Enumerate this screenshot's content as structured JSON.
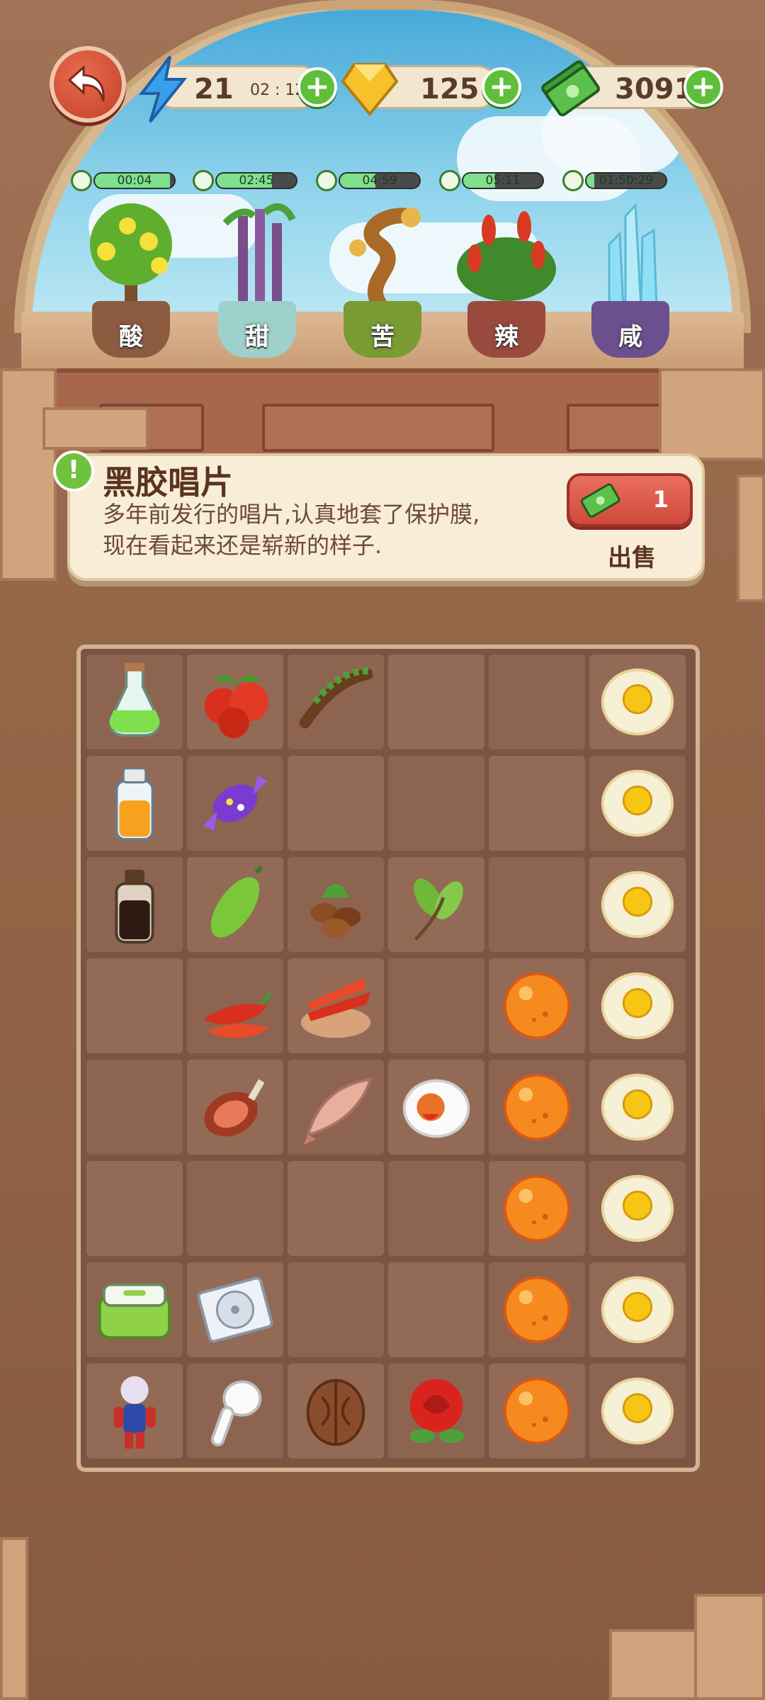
{
  "hud": {
    "energy": "21",
    "energy_timer": "02 : 12",
    "gems": "125",
    "cash": "30911",
    "plus": "+"
  },
  "plants": [
    {
      "label": "酸",
      "timer": "00:04",
      "progress": 0.95,
      "pot_color": "#8d5b3f"
    },
    {
      "label": "甜",
      "timer": "02:45",
      "progress": 0.7,
      "pot_color": "#9fd1cc"
    },
    {
      "label": "苦",
      "timer": "04:59",
      "progress": 0.45,
      "pot_color": "#7a9a32"
    },
    {
      "label": "辣",
      "timer": "05:11",
      "progress": 0.4,
      "pot_color": "#9a4a3d"
    },
    {
      "label": "咸",
      "timer": "01:50:29",
      "progress": 0.1,
      "pot_color": "#6c4f8f"
    }
  ],
  "info": {
    "badge": "!",
    "title": "黑胶唱片",
    "desc_line1": "多年前发行的唱片,认真地套了保护膜,",
    "desc_line2": "现在看起来还是崭新的样子.",
    "sell_count": "1",
    "sell_label": "出售"
  },
  "grid": [
    [
      "green-potion",
      "red-berries",
      "tamarind",
      "",
      "",
      "fried-egg"
    ],
    [
      "orange-juice-bottle",
      "purple-candy",
      "",
      "",
      "",
      "fried-egg"
    ],
    [
      "soy-sauce-bottle",
      "bitter-melon",
      "coffee-beans",
      "tea-leaves",
      "",
      "fried-egg"
    ],
    [
      "",
      "red-chilies",
      "chili-bowl",
      "",
      "orange-orb",
      "fried-egg"
    ],
    [
      "",
      "ham-leg",
      "dried-fish",
      "salted-egg",
      "orange-orb",
      "fried-egg"
    ],
    [
      "",
      "",
      "",
      "",
      "orange-orb",
      "fried-egg"
    ],
    [
      "lunch-box",
      "vinyl-record",
      "",
      "",
      "orange-orb",
      "fried-egg"
    ],
    [
      "toy-figure",
      "earbud",
      "walnut",
      "red-rose",
      "orange-orb",
      "fried-egg"
    ]
  ],
  "colors": {
    "accent_green": "#5fbf3a",
    "sell_red": "#d9554a",
    "board_bg": "#7b5542"
  }
}
